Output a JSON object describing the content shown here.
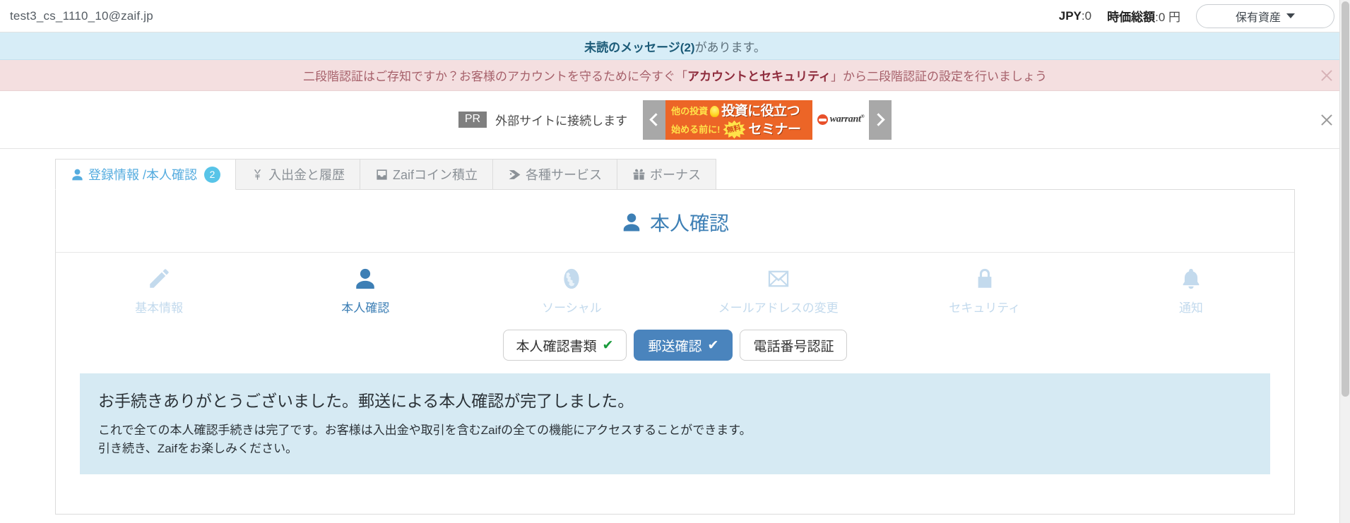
{
  "topbar": {
    "account_email": "test3_cs_1110_10@zaif.jp",
    "jpy_key": "JPY",
    "jpy_value": ":0",
    "market_key": "時価総額",
    "market_value": ":0 円",
    "assets_button": "保有資産",
    "caret_icon": "chevron-down-icon"
  },
  "notice_blue": {
    "bold": "未読のメッセージ(2)",
    "rest": "があります。"
  },
  "notice_pink": {
    "lead": "二段階認証はご存知ですか？お客様のアカウントを守るために今すぐ「",
    "bold": "アカウントとセキュリティ",
    "tail": "」から二段階認証の設定を行いましょう",
    "close_icon": "close-icon"
  },
  "ad": {
    "pr_badge": "PR",
    "pr_label": "外部サイトに接続します",
    "prev_icon": "chevron-left-icon",
    "next_icon": "chevron-right-icon",
    "banner_line1_small": "他の投資",
    "banner_line1_big": "投資に役立つ",
    "banner_line2_small": "始める前に!",
    "banner_line2_big": "セミナー",
    "banner_burst": "無料",
    "banner_brand": "warrant",
    "banner_brand_sup": "®",
    "close_icon": "close-icon"
  },
  "tabs": [
    {
      "label": "登録情報 /本人確認",
      "icon": "user-icon",
      "badge": "2",
      "active": true
    },
    {
      "label": "入出金と履歴",
      "icon": "yen-icon",
      "badge": "",
      "active": false
    },
    {
      "label": "Zaifコイン積立",
      "icon": "inbox-icon",
      "badge": "",
      "active": false
    },
    {
      "label": "各種サービス",
      "icon": "tag-icon",
      "badge": "",
      "active": false
    },
    {
      "label": "ボーナス",
      "icon": "gift-icon",
      "badge": "",
      "active": false
    }
  ],
  "panel": {
    "title": "本人確認",
    "title_icon": "user-icon",
    "steps": [
      {
        "label": "基本情報",
        "icon": "pencil-icon",
        "active": false
      },
      {
        "label": "本人確認",
        "icon": "user-icon",
        "active": true
      },
      {
        "label": "ソーシャル",
        "icon": "globe-icon",
        "active": false
      },
      {
        "label": "メールアドレスの変更",
        "icon": "mail-icon",
        "active": false
      },
      {
        "label": "セキュリティ",
        "icon": "lock-icon",
        "active": false
      },
      {
        "label": "通知",
        "icon": "bell-icon",
        "active": false
      }
    ],
    "subtabs": [
      {
        "label": "本人確認書類",
        "check": "✔",
        "selected": false
      },
      {
        "label": "郵送確認",
        "check": "✔",
        "selected": true
      },
      {
        "label": "電話番号認証",
        "check": "",
        "selected": false
      }
    ],
    "success_heading": "お手続きありがとうございました。郵送による本人確認が完了しました。",
    "success_line1": "これで全ての本人確認手続きは完了です。お客様は入出金や取引を含むZaifの全ての機能にアクセスすることができます。",
    "success_line2": "引き続き、Zaifをお楽しみください。"
  },
  "colors": {
    "accent_blue": "#55acdf",
    "panel_title": "#3d7fb5",
    "selected_subtab": "#4a84bd",
    "notice_blue_bg": "#d7edf7",
    "notice_pink_bg": "#f4dfe0",
    "ad_orange": "#ec6527",
    "success_bg": "#d6eaf3",
    "check_green": "#1a9b3c"
  }
}
